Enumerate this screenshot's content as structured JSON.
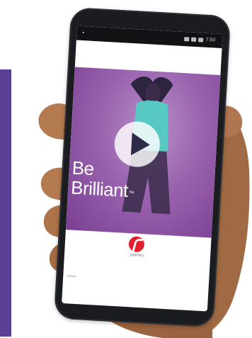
{
  "status_bar": {
    "left_text": "▪",
    "time": "7:50"
  },
  "video": {
    "title_line1": "Be",
    "title_line2": "Brilliant",
    "trademark": "™",
    "play_icon": "play-icon"
  },
  "brand": {
    "logo_icon": "brand-logo-icon",
    "name": "SIMPRO"
  },
  "colors": {
    "panel": "#5a3f97",
    "video_bg": "#9a63ae",
    "phone": "#1b1c1f",
    "logo": "#e0202c"
  }
}
